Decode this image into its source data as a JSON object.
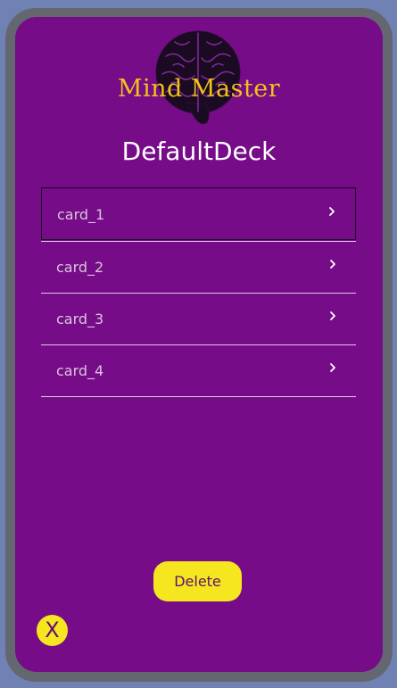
{
  "brand": {
    "logo_text": "Mind Master"
  },
  "deck": {
    "title": "DefaultDeck",
    "cards": [
      {
        "label": "card_1",
        "selected": true
      },
      {
        "label": "card_2",
        "selected": false
      },
      {
        "label": "card_3",
        "selected": false
      },
      {
        "label": "card_4",
        "selected": false
      }
    ]
  },
  "actions": {
    "delete_label": "Delete",
    "close_label": "X"
  },
  "colors": {
    "page_background": "#6f82b3",
    "frame": "#656770",
    "screen": "#760c87",
    "accent_yellow": "#f6e61f",
    "logo_text": "#f3c21a"
  },
  "icons": {
    "logo": "brain-icon",
    "row_action": "chevron-right-icon"
  }
}
